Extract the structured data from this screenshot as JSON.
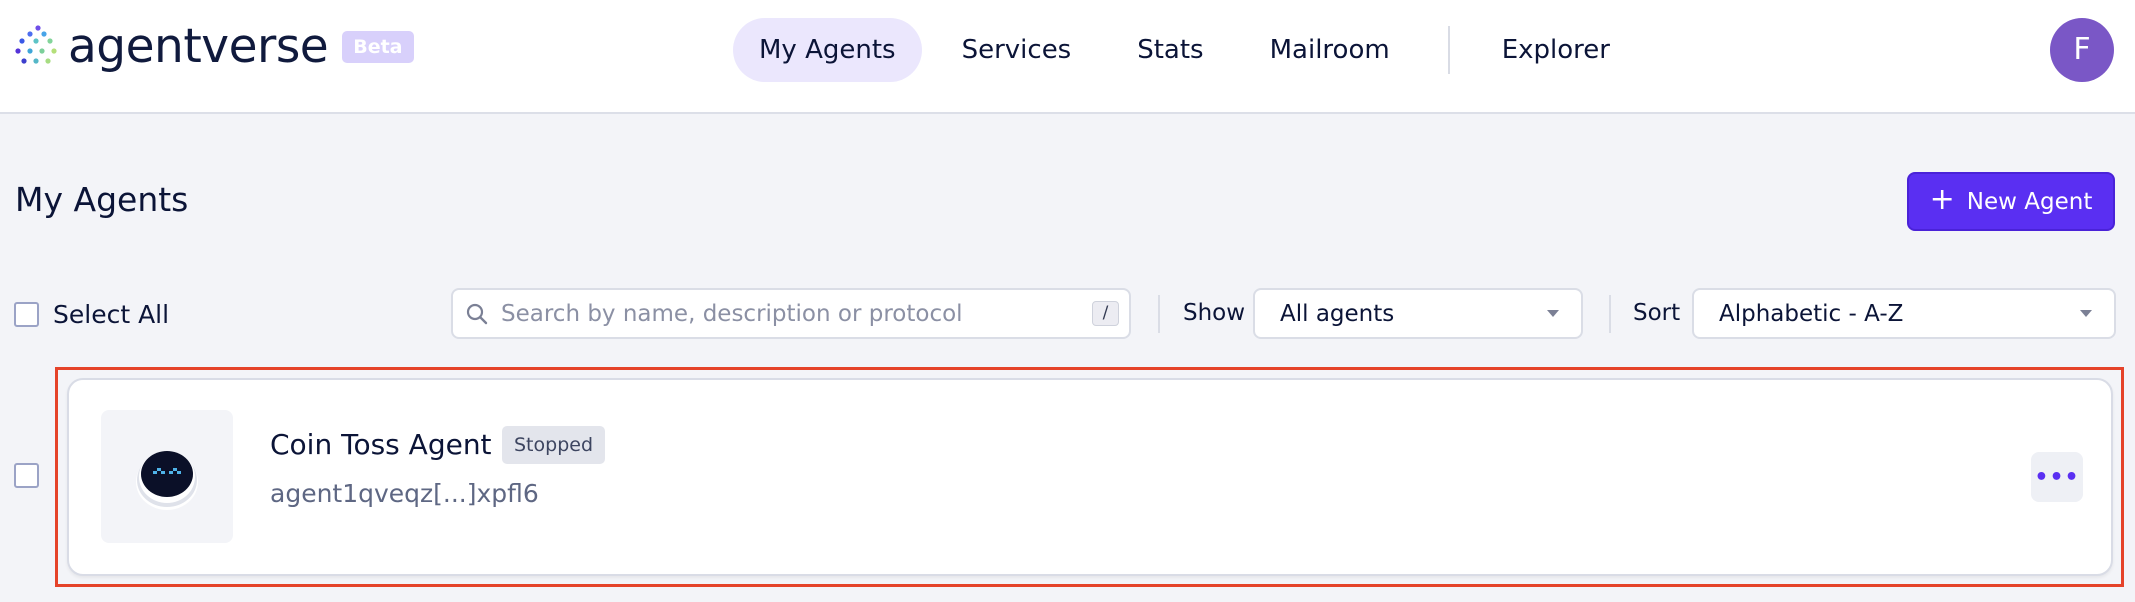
{
  "app": {
    "name": "agentverse",
    "badge": "Beta",
    "brand_color": "#5a2ff2"
  },
  "nav": {
    "items": [
      {
        "label": "My Agents",
        "active": true
      },
      {
        "label": "Services",
        "active": false
      },
      {
        "label": "Stats",
        "active": false
      },
      {
        "label": "Mailroom",
        "active": false
      },
      {
        "label": "Explorer",
        "active": false
      }
    ]
  },
  "user": {
    "avatar_initial": "F",
    "avatar_color": "#7a57c6"
  },
  "page": {
    "title": "My Agents",
    "new_agent_label": "New Agent",
    "new_agent_icon": "plus-icon"
  },
  "toolbar": {
    "select_all_label": "Select All",
    "search_placeholder": "Search by name, description or protocol",
    "search_shortcut": "/",
    "show_label": "Show",
    "show_value": "All agents",
    "sort_label": "Sort",
    "sort_value": "Alphabetic - A-Z"
  },
  "agents": [
    {
      "name": "Coin Toss Agent",
      "status": "Stopped",
      "address": "agent1qveqz[...]xpfl6",
      "icon": "robot-avatar-icon",
      "more_label": "•••"
    }
  ],
  "highlight_color": "#e5432a"
}
